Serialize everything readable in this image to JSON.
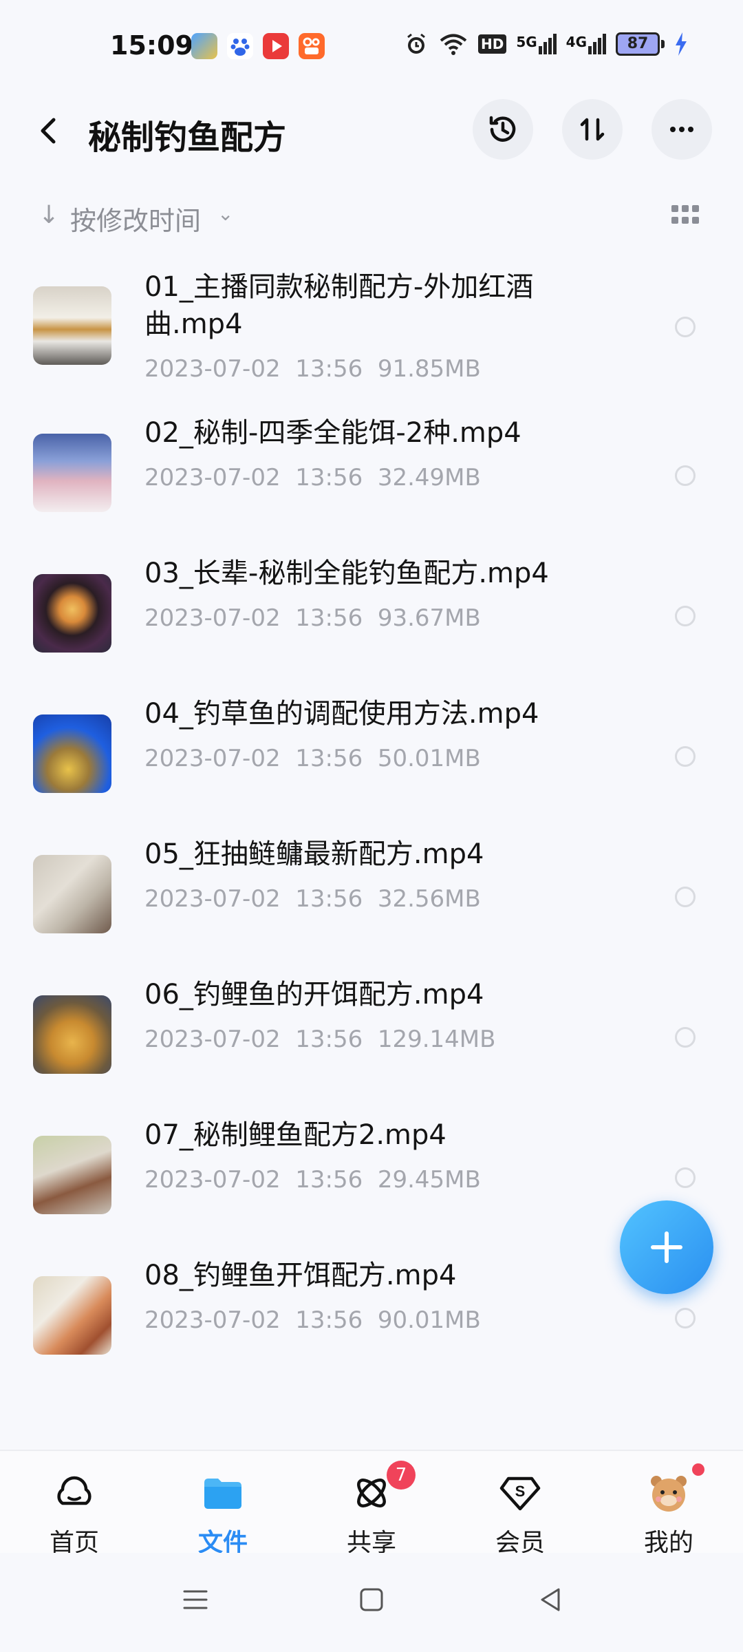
{
  "status_bar": {
    "time": "15:09",
    "battery": "87",
    "icons": [
      "alarm-icon",
      "wifi-icon",
      "hd-icon",
      "signal-5g-icon",
      "signal-4g-icon",
      "battery-icon",
      "charging-icon"
    ],
    "network_5g": "5G",
    "network_4g": "4G",
    "hd": "HD"
  },
  "header": {
    "title": "秘制钓鱼配方",
    "actions": [
      "history-icon",
      "transfer-icon",
      "more-icon"
    ]
  },
  "sort": {
    "label": "按修改时间"
  },
  "files": [
    {
      "name": "01_主播同款秘制配方-外加红酒曲.mp4",
      "date": "2023-07-02",
      "time": "13:56",
      "size": "91.85MB"
    },
    {
      "name": "02_秘制-四季全能饵-2种.mp4",
      "date": "2023-07-02",
      "time": "13:56",
      "size": "32.49MB"
    },
    {
      "name": "03_长辈-秘制全能钓鱼配方.mp4",
      "date": "2023-07-02",
      "time": "13:56",
      "size": "93.67MB"
    },
    {
      "name": "04_钓草鱼的调配使用方法.mp4",
      "date": "2023-07-02",
      "time": "13:56",
      "size": "50.01MB"
    },
    {
      "name": "05_狂抽鲢鳙最新配方.mp4",
      "date": "2023-07-02",
      "time": "13:56",
      "size": "32.56MB"
    },
    {
      "name": "06_钓鲤鱼的开饵配方.mp4",
      "date": "2023-07-02",
      "time": "13:56",
      "size": "129.14MB"
    },
    {
      "name": "07_秘制鲤鱼配方2.mp4",
      "date": "2023-07-02",
      "time": "13:56",
      "size": "29.45MB"
    },
    {
      "name": "08_钓鲤鱼开饵配方.mp4",
      "date": "2023-07-02",
      "time": "13:56",
      "size": "90.01MB"
    }
  ],
  "bottom_nav": {
    "items": [
      {
        "label": "首页",
        "icon": "cloud-home-icon"
      },
      {
        "label": "文件",
        "icon": "folder-icon",
        "active": true
      },
      {
        "label": "共享",
        "icon": "share-atom-icon",
        "badge": "7"
      },
      {
        "label": "会员",
        "icon": "vip-diamond-icon"
      },
      {
        "label": "我的",
        "icon": "avatar-icon"
      }
    ]
  },
  "colors": {
    "accent": "#2b8cf4",
    "background": "#f7f8fc",
    "badge": "#f0435a"
  }
}
